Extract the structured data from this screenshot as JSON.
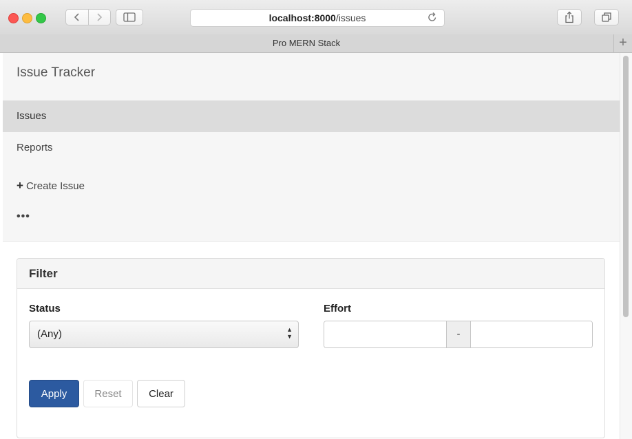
{
  "browser": {
    "address_host": "localhost:8000",
    "address_path": "/issues",
    "tab_title": "Pro MERN Stack",
    "new_tab_symbol": "+"
  },
  "app": {
    "brand": "Issue Tracker",
    "nav": {
      "issues": "Issues",
      "reports": "Reports",
      "create_issue": "Create Issue",
      "more": "•••"
    }
  },
  "filter": {
    "title": "Filter",
    "status_label": "Status",
    "status_value": "(Any)",
    "effort_label": "Effort",
    "effort_min_value": "",
    "effort_separator": "-",
    "effort_max_value": "",
    "apply_label": "Apply",
    "reset_label": "Reset",
    "clear_label": "Clear"
  },
  "colors": {
    "primary_button": "#2c5aa0",
    "active_nav_bg": "#dcdcdc"
  },
  "icons": {
    "back": "chevron-left-icon",
    "forward": "chevron-right-icon",
    "sidebar": "sidebar-icon",
    "reload": "reload-icon",
    "share": "share-icon",
    "tabs": "tabs-overview-icon",
    "create": "plus-icon",
    "select": "select-arrows-icon"
  }
}
